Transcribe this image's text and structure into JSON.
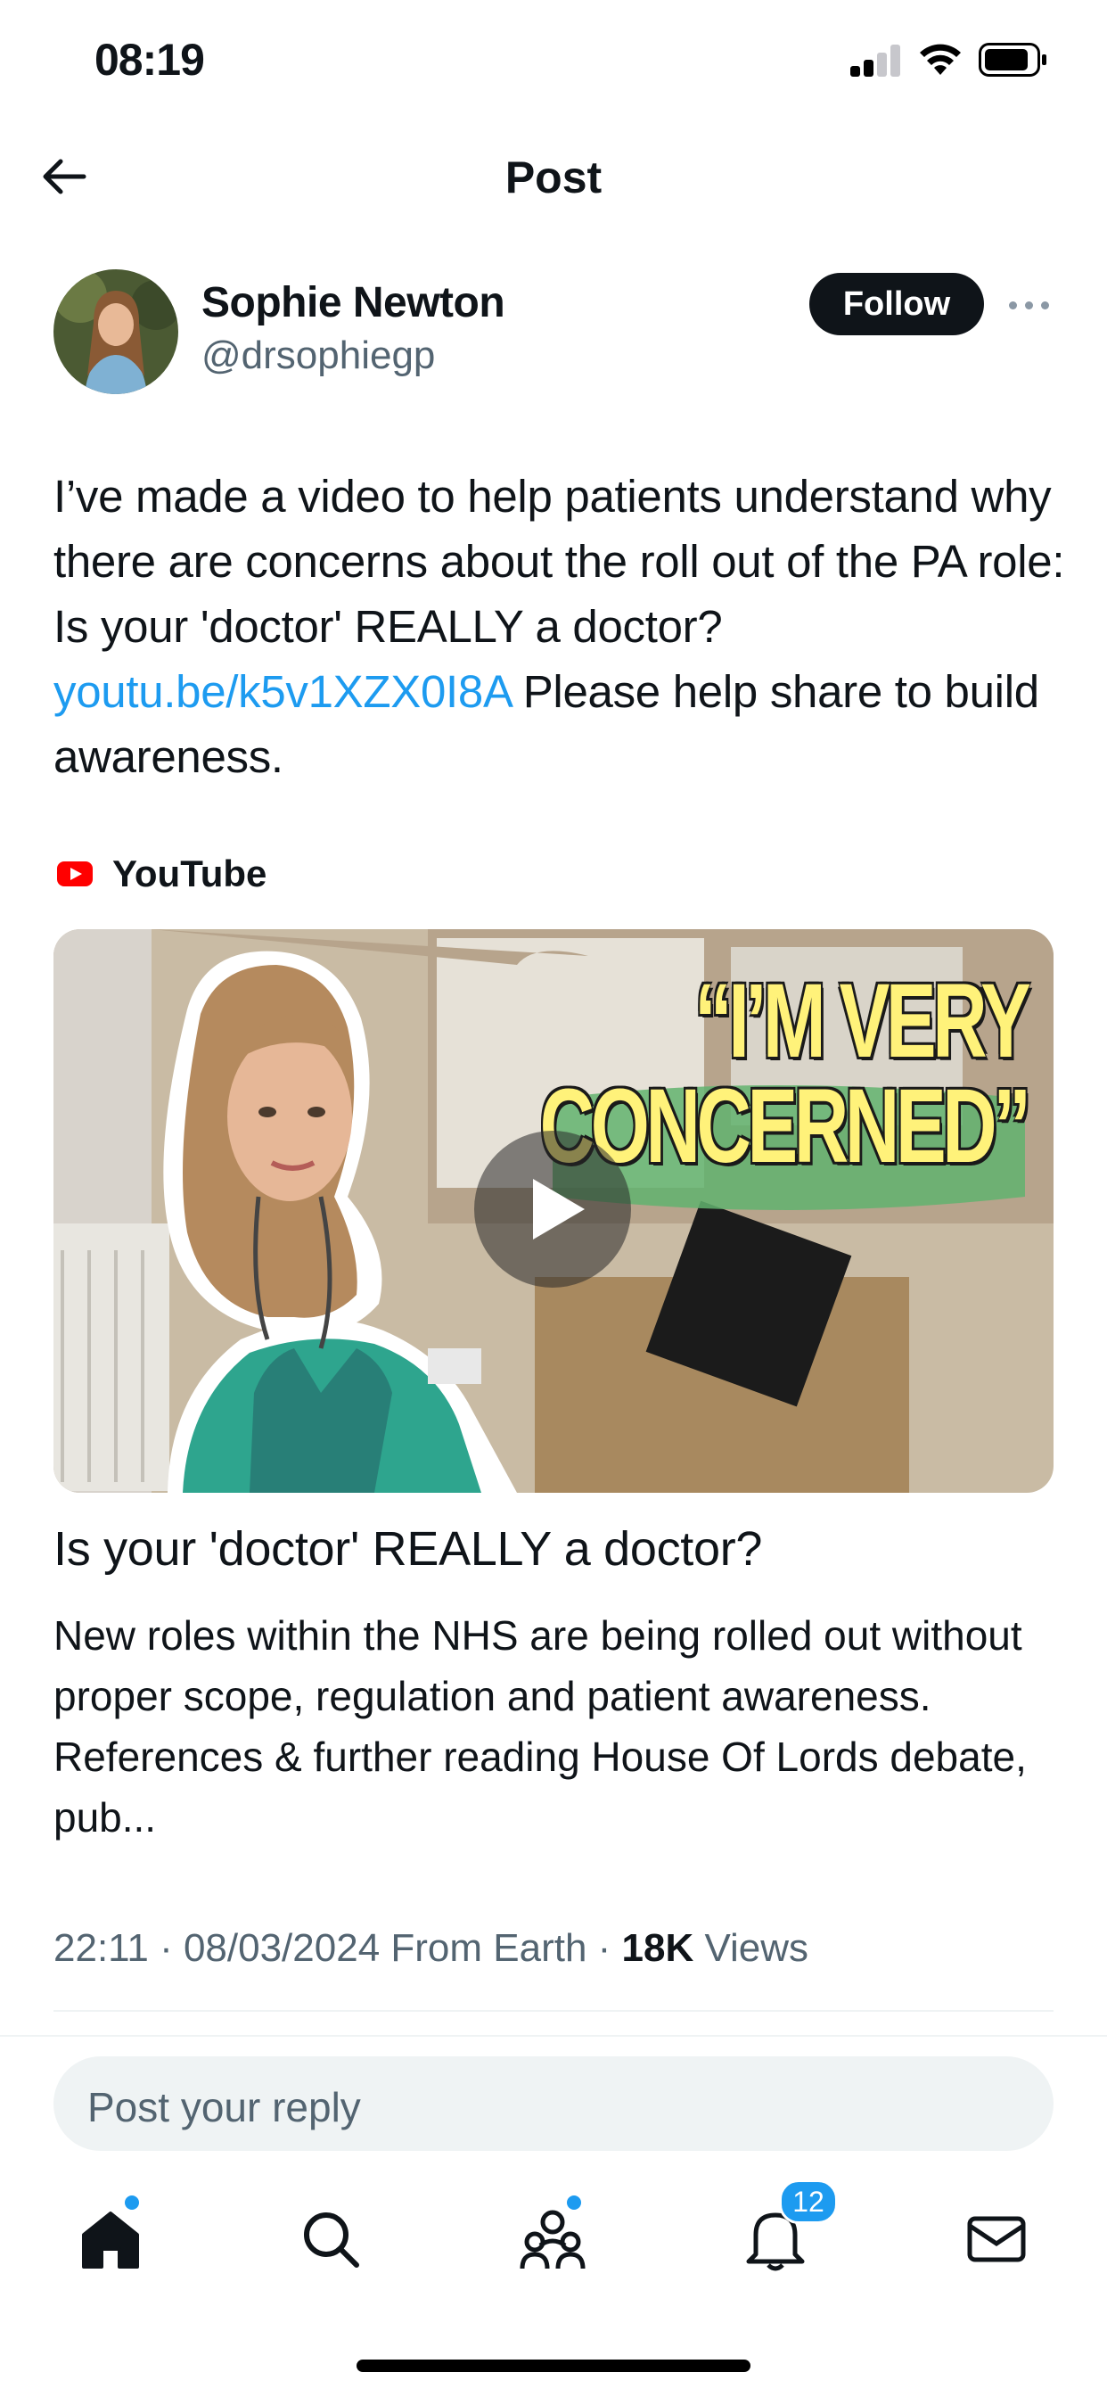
{
  "status_bar": {
    "time": "08:19"
  },
  "header": {
    "title": "Post"
  },
  "author": {
    "name": "Sophie Newton",
    "handle": "@drsophiegp",
    "follow_label": "Follow"
  },
  "post": {
    "text_before_link": "I’ve made a video to help patients understand why there are concerns about the roll out of the PA role: Is your 'doctor' REALLY a doctor? ",
    "link": "youtu.be/k5v1XZX0I8A",
    "text_after_link": " Please help share to build awareness."
  },
  "card": {
    "source": "YouTube",
    "thumbnail_line1": "“I’M VERY",
    "thumbnail_line2": "CONCERNED”",
    "title": "Is your 'doctor' REALLY a doctor?",
    "description": "New roles within the NHS are being rolled out without proper scope, regulation and patient awareness. References & further reading House Of Lords debate, pub..."
  },
  "meta": {
    "time_date_source": "22:11 · 08/03/2024 From Earth · ",
    "views_count": "18K",
    "views_label": " Views"
  },
  "reply": {
    "placeholder": "Post your reply"
  },
  "tabbar": {
    "notifications_badge": "12"
  },
  "colors": {
    "accent": "#1d9bf0",
    "text": "#0f1419",
    "secondary": "#536471",
    "thumbnail_text": "#fff27a"
  }
}
